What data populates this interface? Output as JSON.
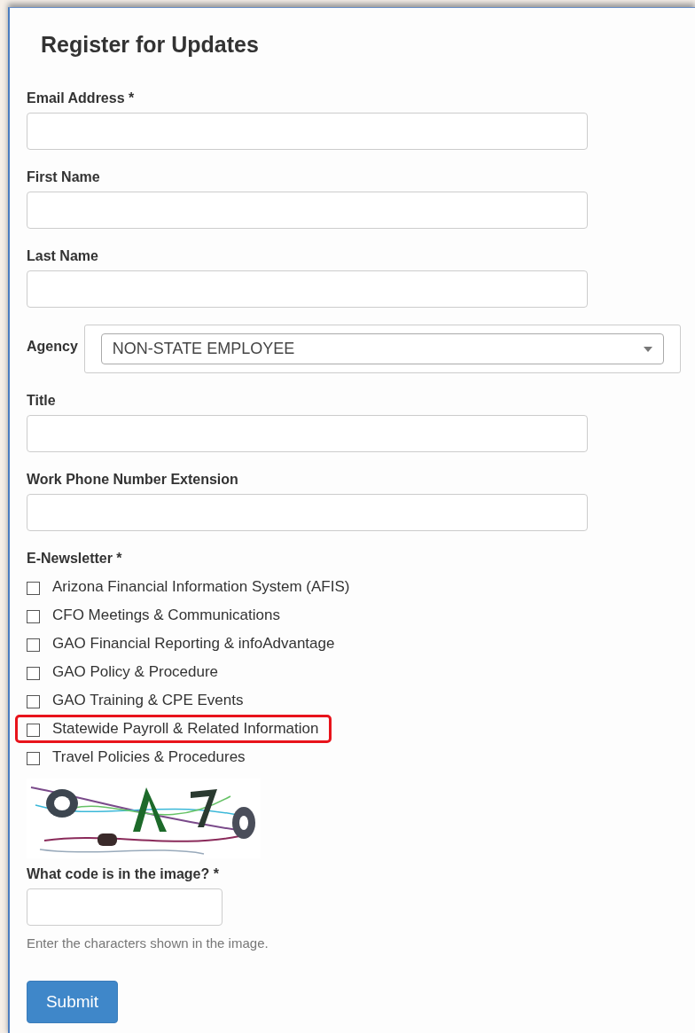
{
  "title": "Register for Updates",
  "fields": [
    {
      "kind": "text",
      "label": "Email Address *"
    },
    {
      "kind": "text",
      "label": "First Name"
    },
    {
      "kind": "text",
      "label": "Last Name"
    },
    {
      "kind": "select",
      "label": "Agency",
      "value": "NON-STATE EMPLOYEE"
    },
    {
      "kind": "text",
      "label": "Title"
    },
    {
      "kind": "text",
      "label": "Work Phone Number Extension"
    }
  ],
  "newsletter": {
    "label": "E-Newsletter *",
    "options": [
      {
        "label": "Arizona Financial Information System (AFIS)",
        "checked": false,
        "highlighted": false
      },
      {
        "label": "CFO Meetings & Communications",
        "checked": false,
        "highlighted": false
      },
      {
        "label": "GAO Financial Reporting & infoAdvantage",
        "checked": false,
        "highlighted": false
      },
      {
        "label": "GAO Policy & Procedure",
        "checked": false,
        "highlighted": false
      },
      {
        "label": "GAO Training & CPE Events",
        "checked": false,
        "highlighted": false
      },
      {
        "label": "Statewide Payroll & Related Information",
        "checked": false,
        "highlighted": true
      },
      {
        "label": "Travel Policies & Procedures",
        "checked": false,
        "highlighted": false
      }
    ]
  },
  "captcha": {
    "label": "What code is in the image? *",
    "help": "Enter the characters shown in the image."
  },
  "submit": "Submit"
}
